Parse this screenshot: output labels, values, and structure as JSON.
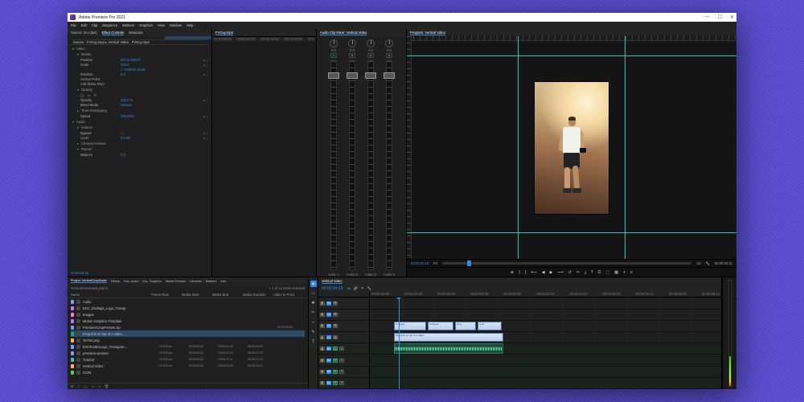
{
  "app": {
    "title": "Adobe Premiere Pro 2021"
  },
  "menu": [
    "File",
    "Edit",
    "Clip",
    "Sequence",
    "Markers",
    "Graphics",
    "View",
    "Window",
    "Help"
  ],
  "effect_controls": {
    "tabs": [
      "Source: (no clips)",
      "Effect Controls",
      "Metadata"
    ],
    "clip_title": "Source · FVGuy.mp4   ▸  Vertical Video · FVGuy.mp4",
    "sections": {
      "video_header": "Video",
      "motion": {
        "label": "Motion",
        "position": {
          "label": "Position",
          "value": "607.5   1080.0"
        },
        "scale": {
          "label": "Scale",
          "value": "100.0"
        },
        "uniform": {
          "label": "",
          "value": "✔ Uniform Scale"
        },
        "rotation": {
          "label": "Rotation",
          "value": "0.0"
        },
        "anchor": {
          "label": "Anchor Point",
          "value": ""
        },
        "flicker": {
          "label": "Anti-flicker Filter",
          "value": ""
        }
      },
      "opacity": {
        "label": "Opacity",
        "opacity": {
          "label": "Opacity",
          "value": "100.0 %"
        },
        "blend": {
          "label": "Blend Mode",
          "value": "Normal"
        }
      },
      "time": {
        "label": "Time Remapping",
        "speed": {
          "label": "Speed",
          "value": "100.00%"
        }
      },
      "audio_header": "Audio",
      "volume": {
        "label": "Volume",
        "bypass": {
          "label": "Bypass",
          "value": "☐"
        },
        "level": {
          "label": "Level",
          "value": "0.0 dB"
        }
      },
      "channel": {
        "label": "Channel Volume"
      },
      "panner": {
        "label": "Panner",
        "balance": {
          "label": "Balance",
          "value": "0.0"
        }
      }
    },
    "timecode": "00:00:04:18"
  },
  "source_panel": {
    "clip": "FVGuy.mp4",
    "ruler": [
      "00:00:00:00",
      "00:00:02:00",
      "00:00:12:00",
      "00:00:20:00",
      "00:0"
    ]
  },
  "mixer": {
    "title": "Audio Clip Mixer: Vertical Video",
    "channels": [
      {
        "name": "Audio 1",
        "solo": "S"
      },
      {
        "name": "Audio 2",
        "solo": "S"
      },
      {
        "name": "Audio 3",
        "solo": "S"
      },
      {
        "name": "Audio 4",
        "solo": "S"
      }
    ]
  },
  "program": {
    "title": "Program: Vertical Video",
    "timecode": "00:00:04:18",
    "fit": "Fit",
    "quality": "1/2",
    "duration": "00:00:20:21",
    "transport": [
      "⎆",
      "{",
      "}",
      "⟵",
      "◀",
      "▶",
      "⟶",
      "↺",
      "✂",
      "⤓",
      "⤒",
      "⎚",
      "⬚",
      "▦",
      "+",
      "≡"
    ]
  },
  "project": {
    "tabs": [
      "Project: VerticalCropGuide",
      "Effects",
      "Ess. Audio",
      "Ess. Graphics",
      "Media Browser",
      "Libraries",
      "Markers",
      "Info"
    ],
    "name": "VerticalCropGuide.prproj",
    "filter_placeholder": "",
    "count": "1 of 14 items selected",
    "columns": [
      "Name",
      "Frame Rate",
      "Media Start",
      "Media End",
      "Media Duration",
      "Video In Point"
    ],
    "items": [
      {
        "swatch": "#7aa0ff",
        "name": "Audio",
        "rate": "",
        "start": "",
        "end": "",
        "dur": ""
      },
      {
        "swatch": "#b77aff",
        "name": "EDC_Endtags_Logo_Transp",
        "rate": "",
        "start": "",
        "end": "",
        "dur": ""
      },
      {
        "swatch": "#ff77e8",
        "name": "Images",
        "rate": "",
        "start": "",
        "end": "",
        "dur": ""
      },
      {
        "swatch": "#b77aff",
        "name": "Motion Graphics Template",
        "rate": "",
        "start": "",
        "end": "",
        "dur": ""
      },
      {
        "swatch": "#7aa0ff",
        "name": "PremiereCropPresets.zip",
        "rate": "",
        "start": "",
        "end": "",
        "dur": "",
        "tc": "00:00:00:00"
      },
      {
        "swatch": "#29a56a",
        "name": "Drag this on top of a video…",
        "rate": "",
        "start": "",
        "end": "",
        "dur": "",
        "sel": true
      },
      {
        "swatch": "#ffb25a",
        "name": "TinTint.png",
        "rate": "",
        "start": "",
        "end": "",
        "dur": ""
      },
      {
        "swatch": "#7aa0ff",
        "name": "EDCFooterLogo_Transpare…",
        "rate": "23.976 fps",
        "start": "00:00:00:00",
        "end": "00:00:04:23",
        "dur": "00:00:05:00"
      },
      {
        "swatch": "#7aa0ff",
        "name": "premiere-presets",
        "rate": "23.976 fps",
        "start": "00:00:00:00",
        "end": "00:00:07:12",
        "dur": "00:00:07:13"
      },
      {
        "swatch": "#32c8b8",
        "name": "Tutorial",
        "rate": "23.976 fps",
        "start": "00:00:00:00",
        "end": "00:00:27:11",
        "dur": "00:00:27:12"
      },
      {
        "swatch": "#ffb25a",
        "name": "Vertical Video",
        "rate": "23.976 fps",
        "start": "00:00:00:00",
        "end": "00:00:20:20",
        "dur": "00:00:20:21"
      },
      {
        "swatch": "#55cc55",
        "name": "ICON",
        "rate": "",
        "start": "",
        "end": "",
        "dur": ""
      }
    ],
    "footer_icons": [
      "⊞",
      "≡",
      "◯",
      "▭",
      "⌕",
      "🗑"
    ]
  },
  "tools": [
    "▲",
    "▭",
    "✥",
    "✂",
    "⌁",
    "✎",
    "T"
  ],
  "timeline": {
    "sequence": "Vertical Video",
    "timecode": "00:00:04:18",
    "ruler": [
      "00:00:00:00",
      "00:00:01:00",
      "00:00:02:00",
      "00:00:03:00",
      "00:00:04:00",
      "00:00:04:12",
      "00:00:04:18",
      "00:00:05:00",
      "00:00:05:12",
      "00:00:06:00",
      "00:00:06:12"
    ],
    "video_tracks": [
      {
        "name": "V4",
        "clips": []
      },
      {
        "name": "V3",
        "clips": []
      },
      {
        "name": "V2",
        "clips": [
          {
            "l": 30,
            "w": 40,
            "label": "FVGuy2…"
          },
          {
            "l": 72,
            "w": 32,
            "label": "FVGuy4…"
          },
          {
            "l": 106,
            "w": 26,
            "label": "Dog…"
          },
          {
            "l": 134,
            "w": 30,
            "label": "Golf…"
          }
        ]
      },
      {
        "name": "V1",
        "clips": [
          {
            "l": 30,
            "w": 136,
            "label": "Drag this on top of a video…"
          }
        ]
      }
    ],
    "audio_tracks": [
      {
        "name": "A1",
        "clips": [
          {
            "l": 30,
            "w": 136
          }
        ]
      },
      {
        "name": "A2",
        "clips": []
      },
      {
        "name": "A3",
        "clips": []
      },
      {
        "name": "A4",
        "clips": []
      }
    ]
  }
}
